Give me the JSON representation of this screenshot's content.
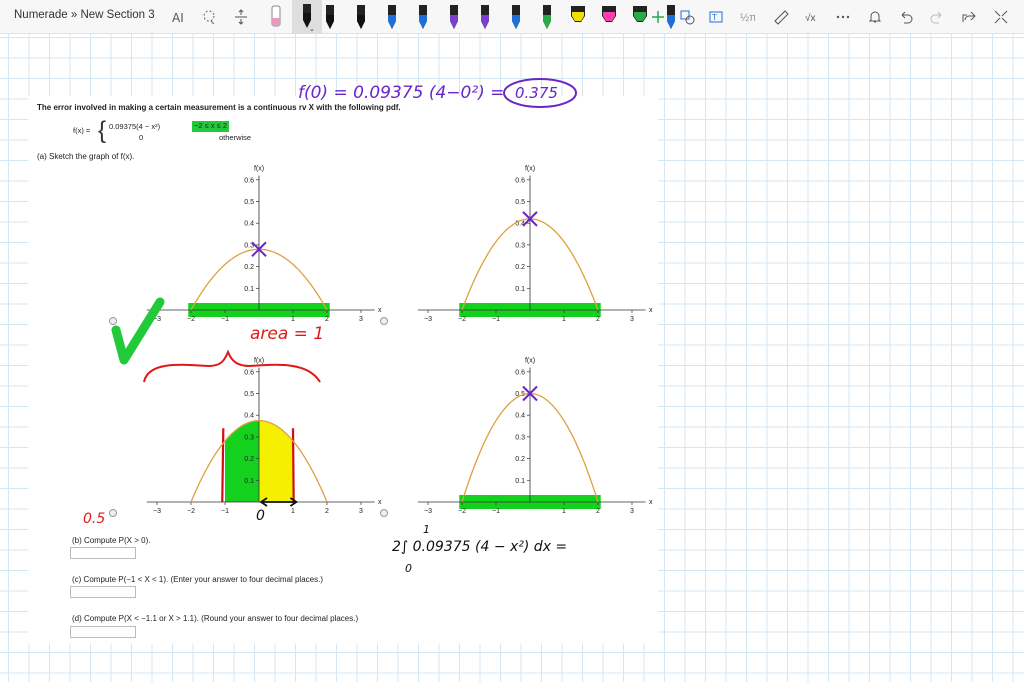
{
  "breadcrumb": "Numerade » New Section 3",
  "toolbar": {
    "pen_colors": [
      "#111111",
      "#111111",
      "#1f6fd8",
      "#1f6fd8",
      "#7b3fcf",
      "#7b3fcf",
      "#1f6fd8",
      "#2aa84a",
      "#f0e000",
      "#ff3fb0",
      "#2aa84a",
      "#1f6fd8"
    ]
  },
  "problem": {
    "intro": "The error involved in making a certain measurement is a continuous rv X with the following pdf.",
    "pdf_lhs": "f(x) =",
    "pdf_case1": "0.09375(4 − x²)",
    "pdf_cond1": "−2 ≤ x ≤ 2",
    "pdf_case2": "0",
    "pdf_cond2": "otherwise",
    "part_a": "(a) Sketch the graph of f(x).",
    "part_b": "(b) Compute P(X > 0).",
    "part_c": "(c) Compute P(−1 < X < 1). (Enter your answer to four decimal places.)",
    "part_d": "(d) Compute P(X < −1.1 or X > 1.1). (Round your answer to four decimal places.)",
    "axis_label": "f(x)",
    "x_label": "x",
    "y_ticks": [
      "0.6",
      "0.5",
      "0.4",
      "0.3",
      "0.2",
      "0.1"
    ],
    "x_ticks": [
      "−3",
      "−2",
      "−1",
      "1",
      "2",
      "3"
    ]
  },
  "handwriting": {
    "f0_eq": "f(0) = 0.09375 (4−0²) =",
    "f0_answer": "0.375",
    "area_note": "area = 1",
    "zero_mark": "0",
    "answer_b": "0.5",
    "integral_expr": "2∫ 0.09375 (4 − x²) dx =",
    "int_upper": "1",
    "int_lower": "0"
  },
  "chart_data": [
    {
      "type": "line",
      "title": "",
      "ylabel": "f(x)",
      "xlabel": "x",
      "xlim": [
        -3,
        3
      ],
      "ylim": [
        0,
        0.6
      ],
      "peak": 0.28,
      "support": [
        -2,
        2
      ]
    },
    {
      "type": "line",
      "title": "",
      "ylabel": "f(x)",
      "xlabel": "x",
      "xlim": [
        -3,
        3
      ],
      "ylim": [
        0,
        0.6
      ],
      "peak": 0.42,
      "support": [
        -2,
        2
      ]
    },
    {
      "type": "line",
      "title": "",
      "ylabel": "f(x)",
      "xlabel": "x",
      "xlim": [
        -3,
        3
      ],
      "ylim": [
        0,
        0.6
      ],
      "peak": 0.375,
      "support": [
        -2,
        2
      ]
    },
    {
      "type": "line",
      "title": "",
      "ylabel": "f(x)",
      "xlabel": "x",
      "xlim": [
        -3,
        3
      ],
      "ylim": [
        0,
        0.6
      ],
      "peak": 0.5,
      "support": [
        -2,
        2
      ]
    }
  ]
}
